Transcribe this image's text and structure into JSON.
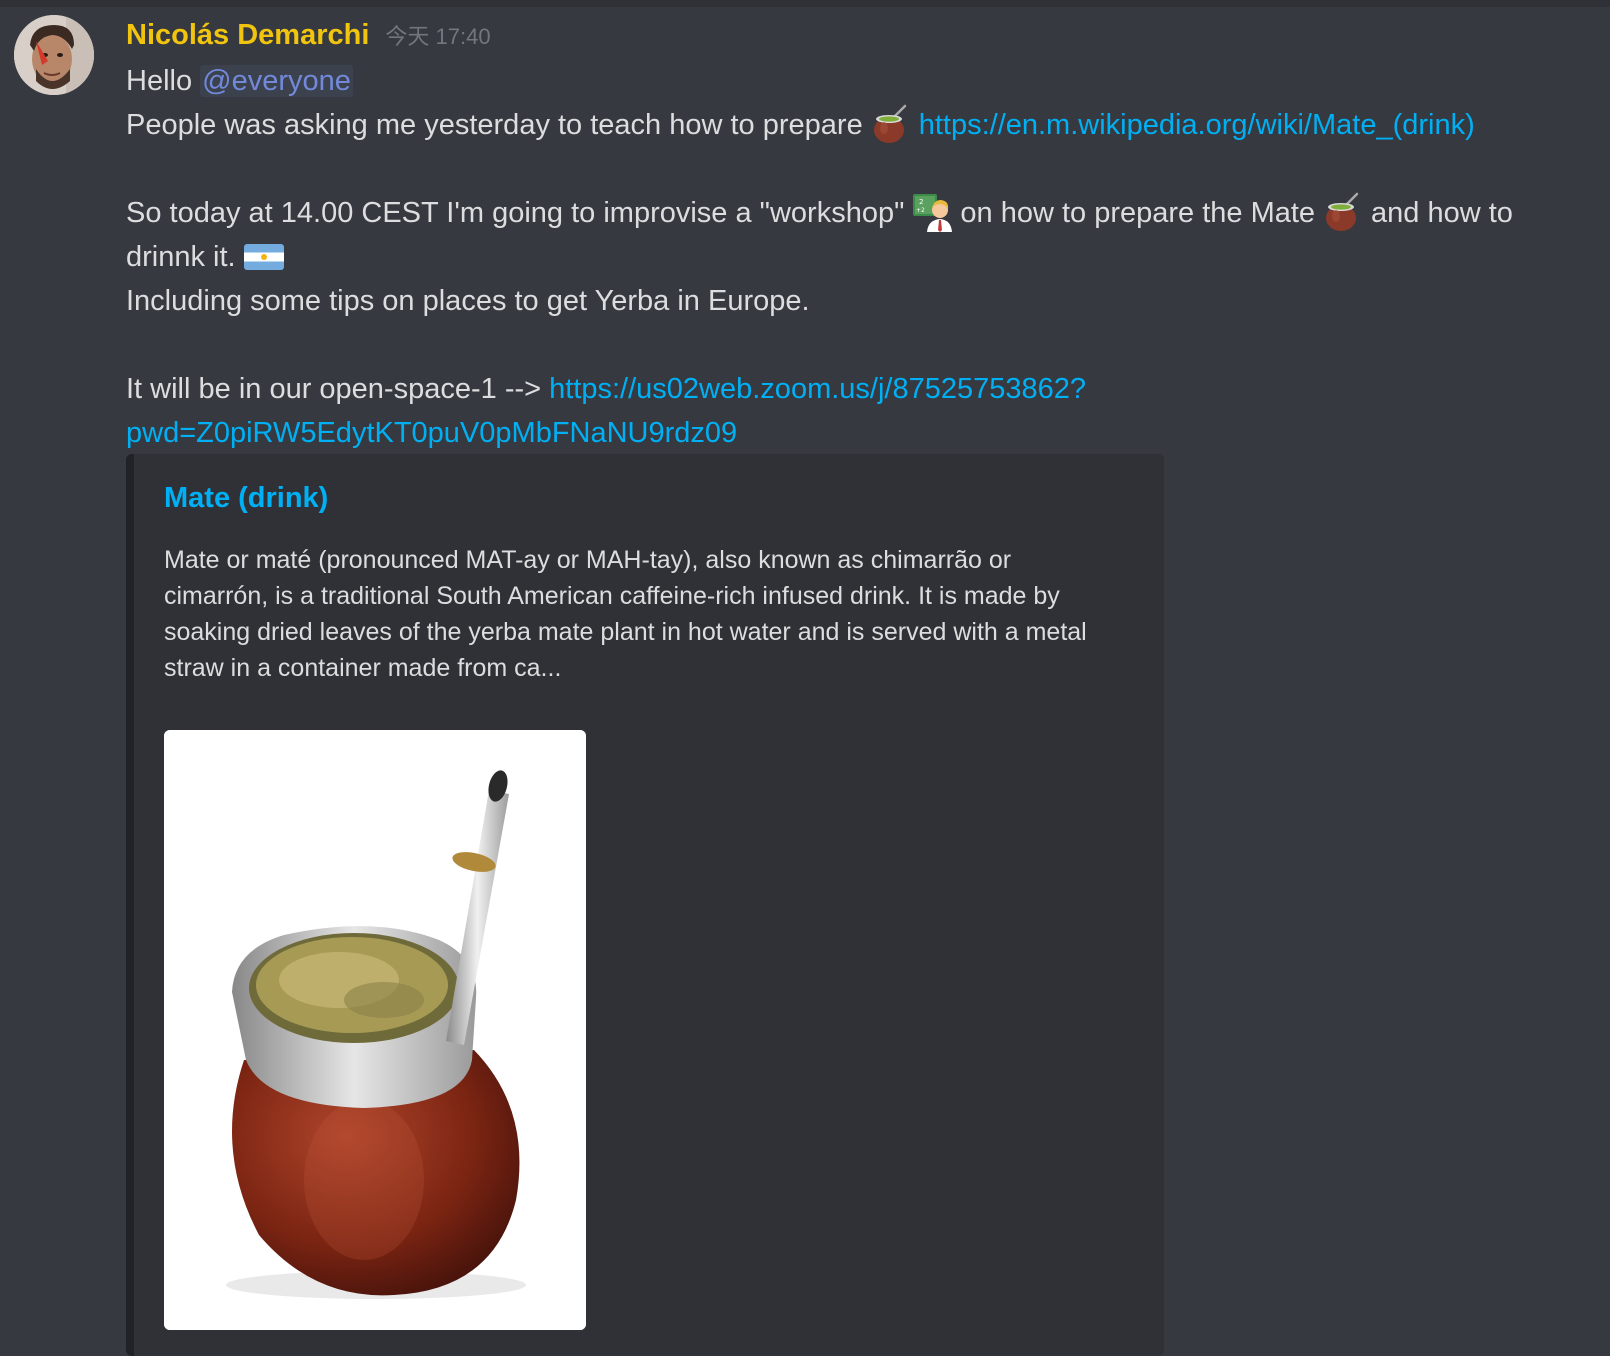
{
  "message": {
    "author": "Nicolás Demarchi",
    "timestamp": "今天 17:40",
    "lines": {
      "hello": "Hello",
      "mention": "@everyone",
      "line1": "People was asking me yesterday to teach how to prepare",
      "link1": "https://en.m.wikipedia.org/wiki/Mate_(drink)",
      "line2a": "So today at 14.00 CEST I'm going to improvise a \"workshop\"",
      "line2b": "on how to prepare the Mate",
      "line2c": "and how to",
      "line3": "drinnk it.",
      "line4": "Including some tips on places to get Yerba in Europe.",
      "line5": "It will be in our open-space-1 -->",
      "link2a": "https://us02web.zoom.us/j/87525753862?",
      "link2b": "pwd=Z0piRW5EdytKT0puV0pMbFNaNU9rdz09"
    },
    "emojis": [
      "mate-icon",
      "teacher-icon",
      "mate-icon",
      "argentina-flag-icon"
    ]
  },
  "embed": {
    "title": "Mate (drink)",
    "description_lines": [
      "Mate or maté (pronounced MAT-ay or MAH-tay), also known as chimarrão or",
      "cimarrón, is a traditional South American caffeine-rich infused drink. It is made by",
      "soaking dried leaves of the yerba mate plant in hot water and is served with a metal",
      "straw in a container made from ca..."
    ],
    "image": "mate-gourd-photo"
  },
  "colors": {
    "background": "#36393f",
    "username": "#f1c40f",
    "link": "#00b0f4",
    "mention": "#7289da",
    "embed_bg": "#2f3136"
  }
}
